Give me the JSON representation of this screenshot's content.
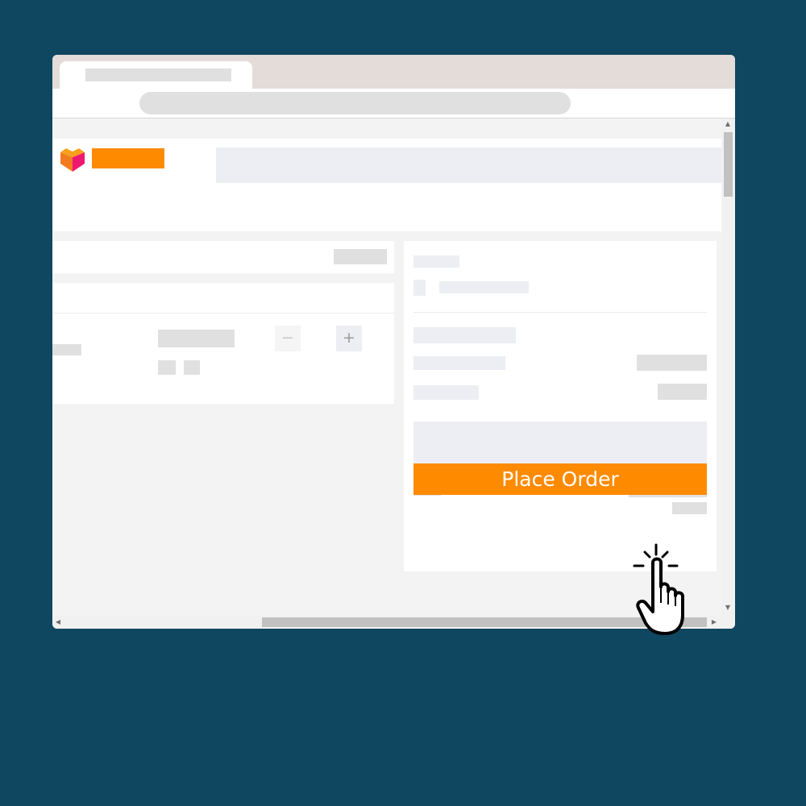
{
  "checkout": {
    "place_order_label": "Place Order",
    "quantity": {
      "decrease_symbol": "−",
      "increase_symbol": "+"
    }
  },
  "icons": {
    "logo": "shop-heart-logo-icon",
    "cursor": "hand-pointer-click-icon"
  },
  "colors": {
    "background": "#0f4660",
    "accent": "#fe8a00"
  }
}
